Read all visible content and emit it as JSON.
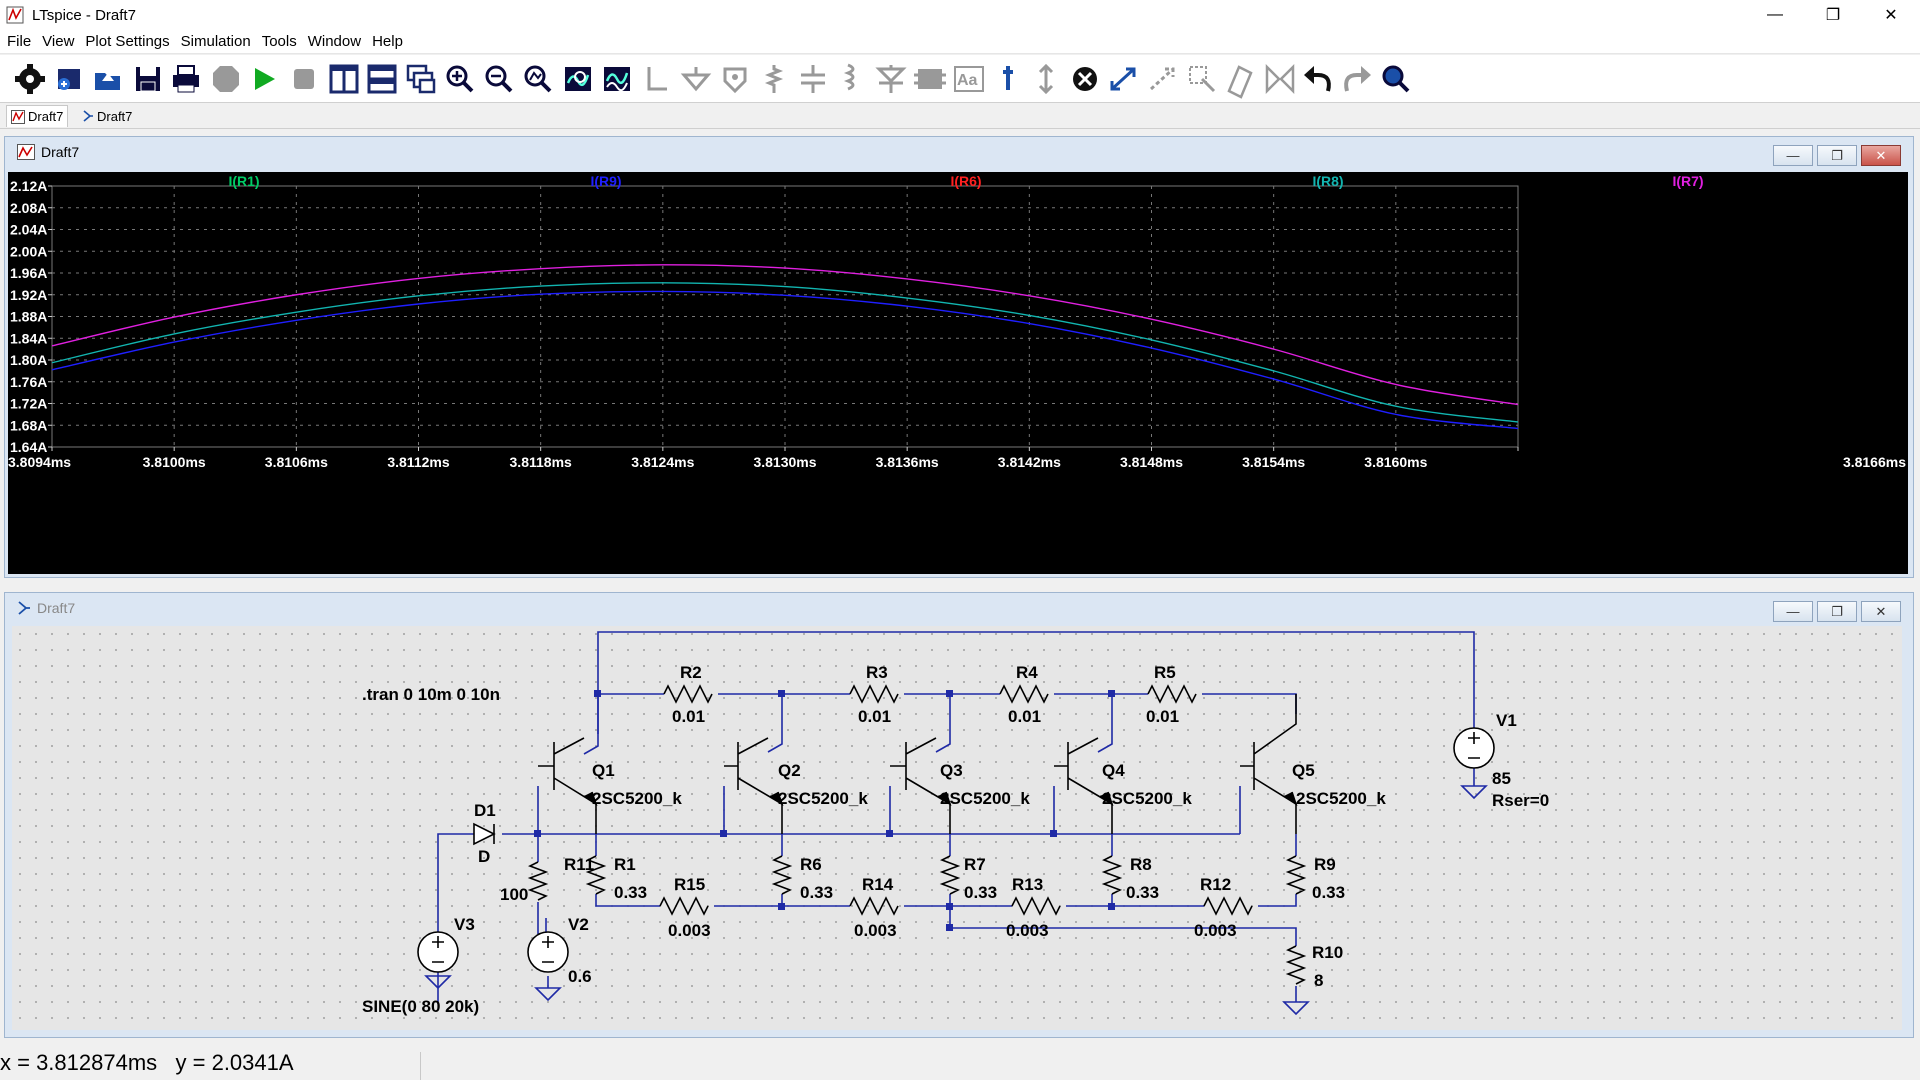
{
  "window": {
    "title": "LTspice - Draft7",
    "controls": [
      "—",
      "❐",
      "✕"
    ]
  },
  "menu": [
    "File",
    "View",
    "Plot Settings",
    "Simulation",
    "Tools",
    "Window",
    "Help"
  ],
  "toolbar": [
    "settings-icon",
    "open-schematic-icon",
    "open-icon",
    "save-icon",
    "print-icon",
    "halt-icon",
    "run-icon",
    "stop-icon",
    "tile-vertical-icon",
    "tile-horizontal-icon",
    "cascade-icon",
    "zoom-in-icon",
    "zoom-out-icon",
    "zoom-fit-icon",
    "autorange-icon",
    "waveform-icon",
    "wire-icon",
    "ground-icon",
    "label-icon",
    "resistor-icon",
    "capacitor-icon",
    "inductor-icon",
    "diode-icon",
    "component-icon",
    "text-icon",
    "spice-directive-icon",
    "move-icon",
    "delete-icon",
    "drag-icon",
    "rotate-icon",
    "mirror-icon",
    "paste-icon",
    "flip-icon",
    "undo-icon",
    "redo-icon",
    "find-icon"
  ],
  "tabs": [
    {
      "label": "Draft7",
      "kind": "plot"
    },
    {
      "label": "Draft7",
      "kind": "schematic"
    }
  ],
  "plot_window": {
    "title": "Draft7"
  },
  "schematic_window": {
    "title": "Draft7"
  },
  "chart_data": {
    "type": "line",
    "title": "",
    "xlabel": "",
    "ylabel": "",
    "x_ticks": [
      "3.8094ms",
      "3.8100ms",
      "3.8106ms",
      "3.8112ms",
      "3.8118ms",
      "3.8124ms",
      "3.8130ms",
      "3.8136ms",
      "3.8142ms",
      "3.8148ms",
      "3.8154ms",
      "3.8160ms",
      "3.8166ms"
    ],
    "y_ticks": [
      "2.12A",
      "2.08A",
      "2.04A",
      "2.00A",
      "1.96A",
      "1.92A",
      "1.88A",
      "1.84A",
      "1.80A",
      "1.76A",
      "1.72A",
      "1.68A",
      "1.64A"
    ],
    "xlim": [
      3.8094,
      3.8166
    ],
    "ylim": [
      1.64,
      2.12
    ],
    "grid": true,
    "legend": [
      "I(R1)",
      "I(R9)",
      "I(R6)",
      "I(R8)",
      "I(R7)"
    ],
    "x": [
      3.8094,
      3.81,
      3.8106,
      3.8112,
      3.8118,
      3.8124,
      3.813,
      3.8136,
      3.8142,
      3.8148,
      3.8154,
      3.816,
      3.8166
    ],
    "series": [
      {
        "name": "I(R1)",
        "color": "#00cc66",
        "values": []
      },
      {
        "name": "I(R9)",
        "color": "#1f1fff",
        "values": [
          1.782,
          1.833,
          1.873,
          1.903,
          1.921,
          1.926,
          1.919,
          1.899,
          1.867,
          1.822,
          1.765,
          1.7,
          1.674
        ]
      },
      {
        "name": "I(R6)",
        "color": "#ff2020",
        "values": []
      },
      {
        "name": "I(R8)",
        "color": "#12b5b0",
        "values": [
          1.795,
          1.848,
          1.888,
          1.918,
          1.936,
          1.942,
          1.935,
          1.914,
          1.882,
          1.837,
          1.78,
          1.715,
          1.686
        ]
      },
      {
        "name": "I(R7)",
        "color": "#e020e0",
        "values": [
          1.826,
          1.879,
          1.92,
          1.95,
          1.968,
          1.975,
          1.969,
          1.949,
          1.918,
          1.875,
          1.82,
          1.755,
          1.718
        ]
      }
    ]
  },
  "schematic": {
    "directive": ".tran 0 10m 0 10n",
    "resistors_top": [
      {
        "name": "R2",
        "value": "0.01"
      },
      {
        "name": "R3",
        "value": "0.01"
      },
      {
        "name": "R4",
        "value": "0.01"
      },
      {
        "name": "R5",
        "value": "0.01"
      }
    ],
    "transistors": [
      {
        "name": "Q1",
        "model": "2SC5200_k"
      },
      {
        "name": "Q2",
        "model": "2SC5200_k"
      },
      {
        "name": "Q3",
        "model": "2SC5200_k"
      },
      {
        "name": "Q4",
        "model": "2SC5200_k"
      },
      {
        "name": "Q5",
        "model": "2SC5200_k"
      }
    ],
    "emitter_resistors": [
      {
        "name": "R1",
        "value": "0.33"
      },
      {
        "name": "R6",
        "value": "0.33"
      },
      {
        "name": "R7",
        "value": "0.33"
      },
      {
        "name": "R8",
        "value": "0.33"
      },
      {
        "name": "R9",
        "value": "0.33"
      }
    ],
    "bottom_resistors": [
      {
        "name": "R15",
        "value": "0.003"
      },
      {
        "name": "R14",
        "value": "0.003"
      },
      {
        "name": "R13",
        "value": "0.003"
      },
      {
        "name": "R12",
        "value": "0.003"
      }
    ],
    "diode": {
      "name": "D1",
      "model": "D"
    },
    "r11": {
      "name": "R11",
      "value": "100"
    },
    "v1": {
      "name": "V1",
      "value": "85",
      "extra": "Rser=0"
    },
    "v2": {
      "name": "V2",
      "value": "0.6"
    },
    "v3": {
      "name": "V3",
      "value": "SINE(0 80 20k)"
    },
    "r10": {
      "name": "R10",
      "value": "8"
    }
  },
  "status": {
    "x": "x = 3.812874ms",
    "y": "y = 2.0341A"
  }
}
